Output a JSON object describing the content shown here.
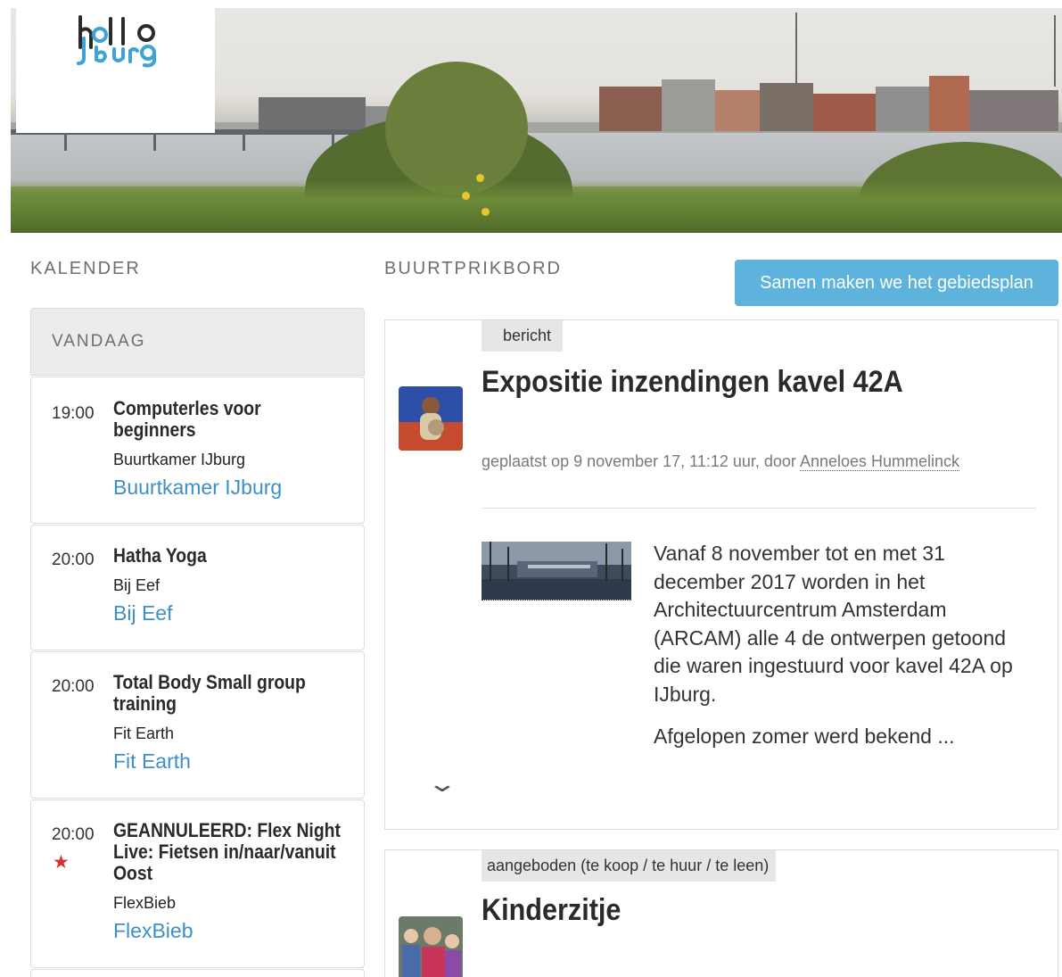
{
  "header": {
    "logo_alt": "hallo IJburg",
    "colors": {
      "logo_dark": "#2b2b2b",
      "logo_blue": "#3fa3d6"
    }
  },
  "sections": {
    "calendar_title": "KALENDER",
    "board_title": "BUURTPRIKBORD",
    "cta_label": "Samen maken we het gebiedsplan"
  },
  "calendar": {
    "today_label": "VANDAAG",
    "events": [
      {
        "time": "19:00",
        "title": "Computerles voor beginners",
        "location": "Buurtkamer IJburg",
        "link": "Buurtkamer IJburg",
        "starred": false
      },
      {
        "time": "20:00",
        "title": "Hatha Yoga",
        "location": "Bij Eef",
        "link": "Bij Eef",
        "starred": false
      },
      {
        "time": "20:00",
        "title": "Total Body Small group training",
        "location": "Fit Earth",
        "link": "Fit Earth",
        "starred": false
      },
      {
        "time": "20:00",
        "title": "GEANNULEERD: Flex Night Live: Fietsen in/naar/vanuit Oost",
        "location": "FlexBieb",
        "link": "FlexBieb",
        "starred": true
      }
    ],
    "star_icon": "★"
  },
  "posts": [
    {
      "tag": "bericht",
      "title": "Expositie inzendingen kavel 42A",
      "meta_prefix": "geplaatst op 9 november 17, 11:12 uur, door ",
      "author": "Anneloes Hummelinck",
      "body_1": "Vanaf 8 november tot en met 31 december 2017 worden in het Architectuurcentrum Amsterdam (ARCAM) alle 4 de ontwerpen getoond die waren ingestuurd voor kavel 42A op IJburg.",
      "body_2": "Afgelopen zomer werd bekend ...",
      "expand_icon": "⌄"
    },
    {
      "tag": "aangeboden (te koop / te huur / te leen)",
      "title": "Kinderzitje"
    }
  ],
  "colors": {
    "accent": "#5db3dc",
    "link": "#3d8fc6",
    "star": "#d63030"
  }
}
